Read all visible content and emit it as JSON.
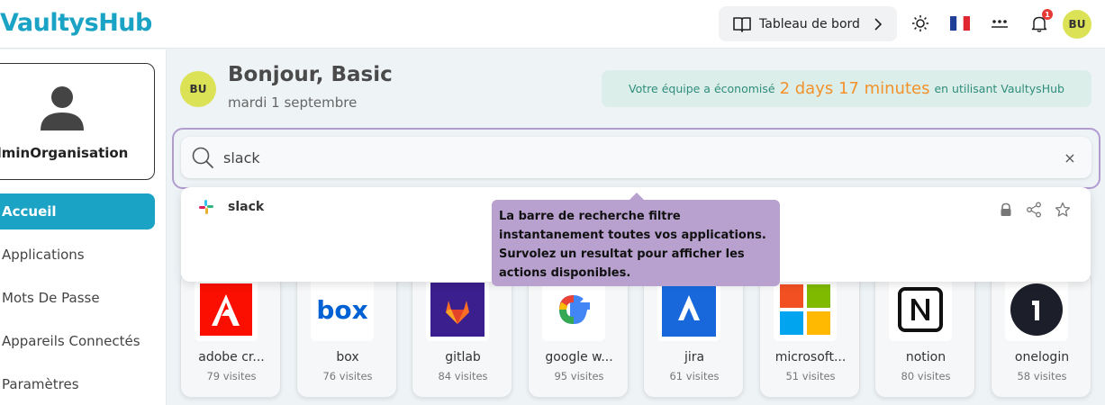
{
  "app": {
    "brand": "VaultysHub",
    "dashboard_label": "Tableau de bord",
    "notification_count": "1",
    "user_initials": "BU"
  },
  "sidebar": {
    "profile_name": "dminOrganisation",
    "items": [
      {
        "label": "Accueil",
        "active": true
      },
      {
        "label": "Applications",
        "active": false
      },
      {
        "label": "Mots De Passe",
        "active": false
      },
      {
        "label": "Appareils Connectés",
        "active": false
      },
      {
        "label": "Paramètres",
        "active": false
      }
    ]
  },
  "main": {
    "avatar_initials": "BU",
    "greeting": "Bonjour, Basic",
    "date": "mardi 1 septembre",
    "savings": {
      "prefix": "Votre équipe a économisé",
      "time": "2 days 17 minutes",
      "suffix": "en utilisant VaultysHub"
    },
    "search": {
      "value": "slack",
      "clear_label": "×"
    },
    "dropdown": {
      "result_label": "slack"
    },
    "tooltip": "La barre de recherche filtre instantanement toutes vos applications. Survolez un resultat pour afficher les actions disponibles.",
    "tiles": [
      {
        "name": "adobe cr...",
        "visits": "79 visites",
        "icon": "adobe-icon"
      },
      {
        "name": "box",
        "visits": "76 visites",
        "icon": "box-icon"
      },
      {
        "name": "gitlab",
        "visits": "84 visites",
        "icon": "gitlab-icon"
      },
      {
        "name": "google w...",
        "visits": "95 visites",
        "icon": "google-icon"
      },
      {
        "name": "jira",
        "visits": "61 visites",
        "icon": "jira-icon"
      },
      {
        "name": "microsoft...",
        "visits": "51 visites",
        "icon": "microsoft-icon"
      },
      {
        "name": "notion",
        "visits": "80 visites",
        "icon": "notion-icon"
      },
      {
        "name": "onelogin",
        "visits": "58 visites",
        "icon": "onelogin-icon"
      }
    ]
  },
  "colors": {
    "brand": "#1aa3c4",
    "active_nav": "#1aa3c4",
    "search_border": "#b19bcf",
    "tooltip_bg": "#b8a1cf",
    "savings_bg": "#dbeee9",
    "savings_time": "#f3912b",
    "avatar_bg": "#dbe256"
  }
}
